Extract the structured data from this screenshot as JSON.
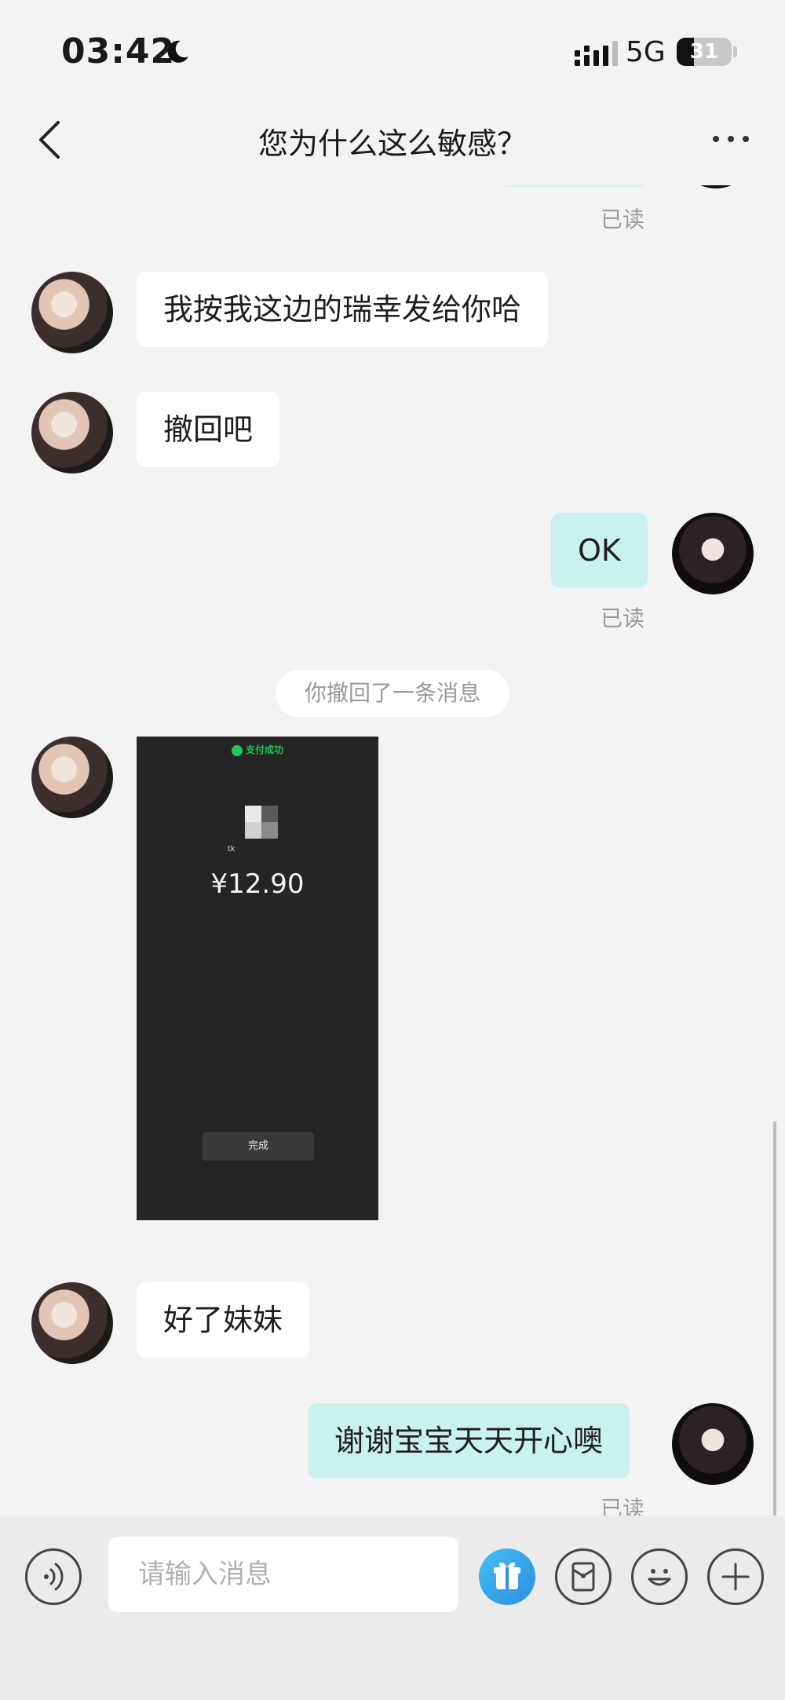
{
  "status_bar": {
    "time": "03:42",
    "network": "5G",
    "battery": "31"
  },
  "nav": {
    "title": "您为什么这么敏感？"
  },
  "messages": [
    {
      "text": "我按我这边的瑞幸发给你哈"
    },
    {
      "text": "撤回吧"
    },
    {
      "text": "OK",
      "status": "已读"
    },
    {
      "text": "好了妹妹"
    },
    {
      "text": "谢谢宝宝天天开心噢",
      "status": "已读"
    }
  ],
  "top_partial_status": "已读",
  "system_note": "你撤回了一条消息",
  "payment_image": {
    "title": "支付成功",
    "merchant": "tk",
    "amount": "¥12.90",
    "done_label": "完成"
  },
  "input": {
    "placeholder": "请输入消息"
  },
  "icons": [
    "moon-icon",
    "signal-icon",
    "battery-icon",
    "back-icon",
    "more-icon",
    "voice-icon",
    "gift-icon",
    "red-packet-icon",
    "emoji-icon",
    "plus-icon"
  ],
  "colors": {
    "outgoing_bubble": "#c9f2ec",
    "incoming_bubble": "#ffffff",
    "pay_success_green": "#21c35a",
    "gift_blue": "#2e8de0"
  }
}
